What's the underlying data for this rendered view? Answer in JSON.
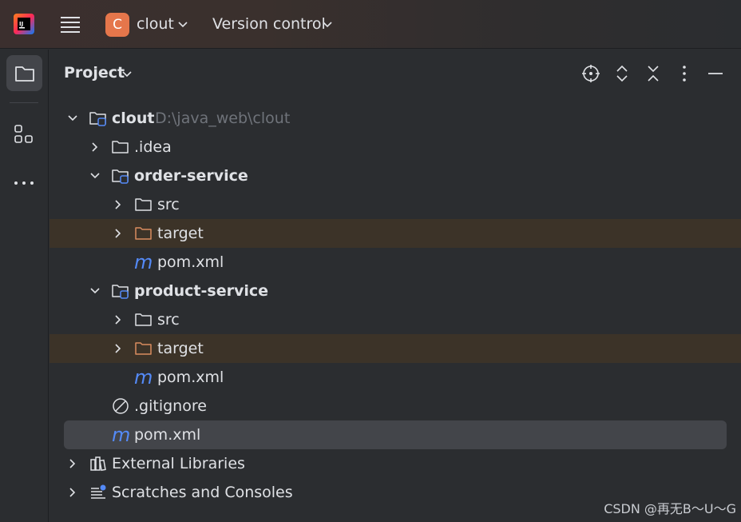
{
  "titlebar": {
    "project_initial": "C",
    "project_name": "clout",
    "version_control_label": "Version control"
  },
  "panel": {
    "title": "Project"
  },
  "tree": {
    "root": {
      "name": "clout",
      "path": "D:\\java_web\\clout"
    },
    "idea": {
      "name": ".idea"
    },
    "order_service": {
      "name": "order-service",
      "src": "src",
      "target": "target",
      "pom": "pom.xml"
    },
    "product_service": {
      "name": "product-service",
      "src": "src",
      "target": "target",
      "pom": "pom.xml"
    },
    "gitignore": ".gitignore",
    "root_pom": "pom.xml",
    "external_libraries": "External Libraries",
    "scratches": "Scratches and Consoles"
  },
  "maven_glyph": "m",
  "watermark": "CSDN @再无B～U～G",
  "colors": {
    "background": "#2b2d30",
    "selected_row": "#43454a",
    "excluded_row": "#3c3328",
    "project_badge": "#e5764b",
    "module_marker": "#548af7",
    "excluded_folder": "#d98c5f"
  }
}
